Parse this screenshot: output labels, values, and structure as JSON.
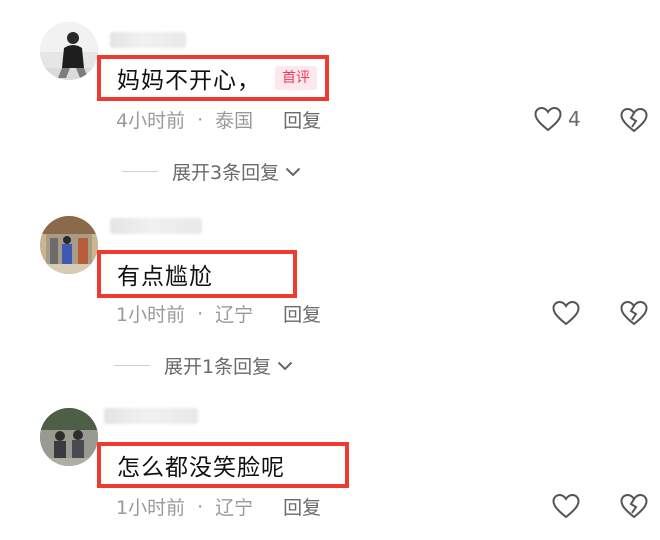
{
  "comments": [
    {
      "text": "妈妈不开心，",
      "badge": "首评",
      "time": "4小时前",
      "separator": "·",
      "location": "泰国",
      "reply_label": "回复",
      "likes": "4",
      "expand_label": "展开3条回复"
    },
    {
      "text": "有点尴尬",
      "time": "1小时前",
      "separator": "·",
      "location": "辽宁",
      "reply_label": "回复",
      "expand_label": "展开1条回复"
    },
    {
      "text": "怎么都没笑脸呢",
      "time": "1小时前",
      "separator": "·",
      "location": "辽宁",
      "reply_label": "回复"
    }
  ],
  "icons": {
    "like": "heart-outline-icon",
    "dislike": "broken-heart-icon",
    "expand": "chevron-down-icon"
  },
  "colors": {
    "highlight_border": "#ee3a2f",
    "badge_text": "#f23a5a",
    "meta_text": "#9a9a9a"
  }
}
